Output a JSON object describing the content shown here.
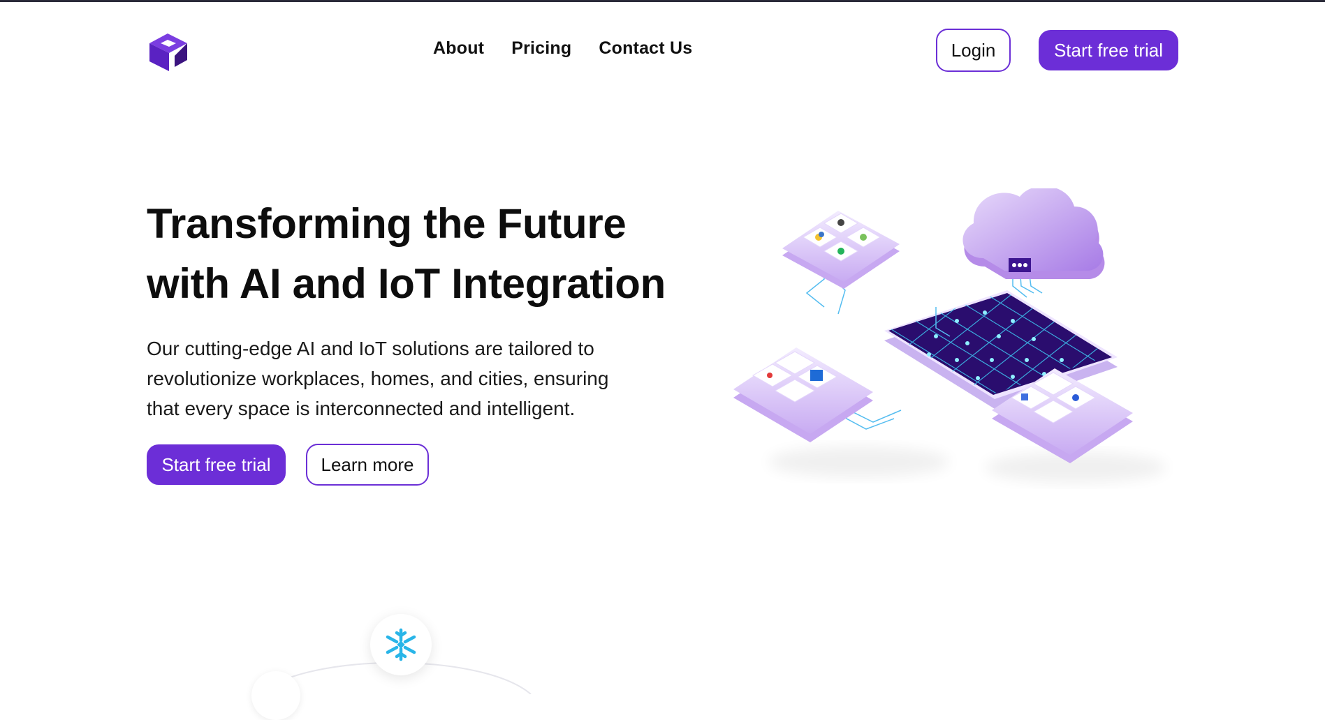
{
  "header": {
    "logo_icon": "cube-logo-icon",
    "nav": [
      {
        "label": "About"
      },
      {
        "label": "Pricing"
      },
      {
        "label": "Contact Us"
      }
    ],
    "login_label": "Login",
    "trial_label": "Start free trial"
  },
  "hero": {
    "title_lines": [
      "Transforming the Future",
      "with AI and IoT Integration"
    ],
    "subtitle_lines": [
      "Our cutting-edge AI and IoT solutions are tailored to",
      "revolutionize workplaces, homes, and cities, ensuring",
      "that every space is interconnected and intelligent."
    ],
    "primary_cta": "Start free trial",
    "secondary_cta": "Learn more",
    "illustration_icon": "iot-cloud-network-illustration"
  },
  "integrations": {
    "featured_icon": "snowflake-icon"
  },
  "colors": {
    "brand": "#6c2ed7",
    "brand_dark": "#3a1480",
    "text": "#111111",
    "cyan": "#31d3f2"
  }
}
